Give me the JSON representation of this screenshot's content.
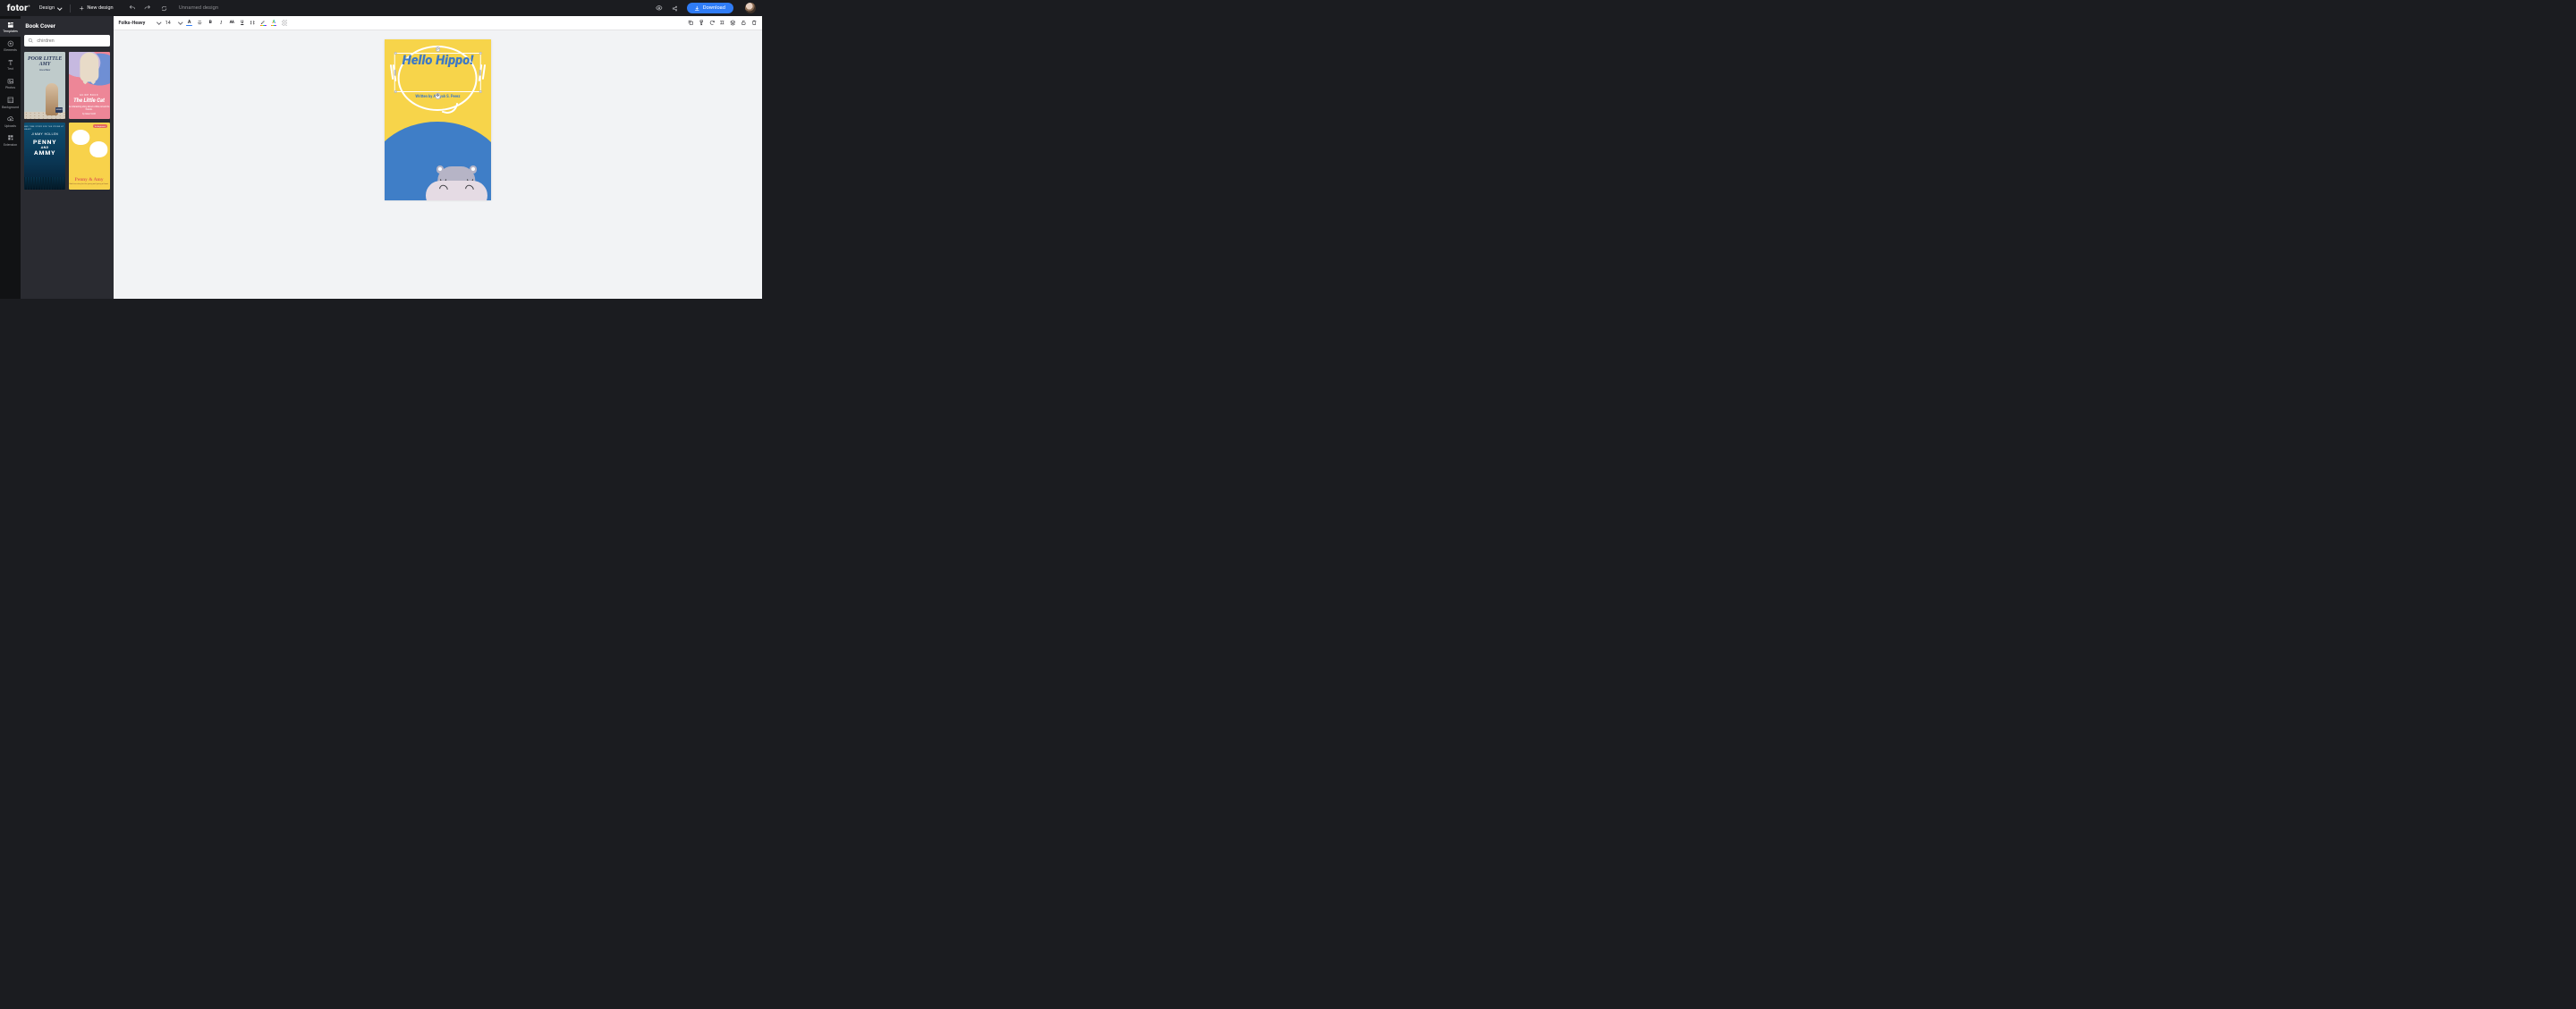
{
  "header": {
    "logo": "fotor",
    "design_label": "Design",
    "new_design_label": "New design",
    "design_name": "Unnamed design",
    "download_label": "Download"
  },
  "rail": {
    "items": [
      {
        "label": "Templates"
      },
      {
        "label": "Elements"
      },
      {
        "label": "Text"
      },
      {
        "label": "Photos"
      },
      {
        "label": "Background"
      },
      {
        "label": "Uploads"
      },
      {
        "label": "Extension"
      }
    ]
  },
  "panel": {
    "title": "Book Cover",
    "search_placeholder": "chirdren",
    "templates": [
      {
        "title": "POOR LITTLE AMY",
        "author": "Grace Baker",
        "tag": "HUNGRY"
      },
      {
        "overline": "GUIDE BOOK",
        "title": "The Little Cat",
        "desc": "An interesting story\nabout a little cat and its friends.",
        "by": "by Isaac Scott"
      },
      {
        "overline": "BED TIME STORY FOR THE YOUNG AT HEART",
        "author": "JIMMY HOLLEN",
        "title1": "PENNY",
        "and": "AND",
        "title2": "AMMY"
      },
      {
        "badge": "for beginners",
        "title": "Penny & Amy",
        "desc": "Bed time story for\nthe young and young at heart."
      }
    ]
  },
  "text_toolbar": {
    "font": "Folks-Heavy",
    "size": "14",
    "text_color": "#2f7cf6"
  },
  "canvas": {
    "headline": "Hello Hippo!",
    "author": "Written by Aaliyah S. Perez"
  }
}
